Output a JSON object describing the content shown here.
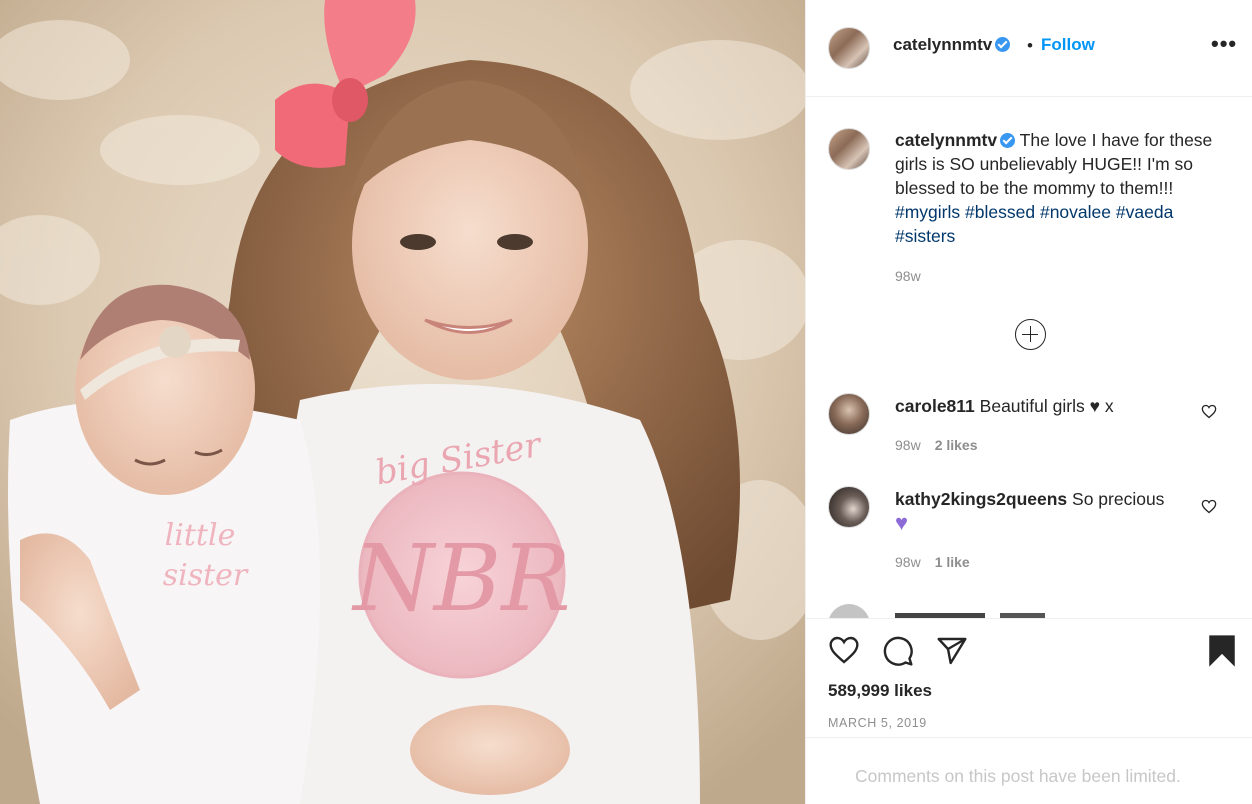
{
  "post": {
    "username": "catelynnmtv",
    "follow_label": "Follow",
    "separator": "•",
    "more_label": "•••",
    "caption_text": " The love I have for these girls is SO unbelievably HUGE!! I'm so blessed to be the mommy to them!!! ",
    "hashtags": [
      "#mygirls",
      "#blessed",
      "#novalee",
      "#vaeda",
      "#sisters"
    ],
    "caption_time": "98w",
    "likes": "589,999 likes",
    "date": "MARCH 5, 2019",
    "limited_notice": "Comments on this post have been limited.",
    "photo_text": {
      "baby_shirt_line1": "little",
      "baby_shirt_line2": "sister",
      "girl_shirt_arc": "big Sister",
      "monogram": "NBR"
    }
  },
  "comments": [
    {
      "username": "carole811",
      "text": " Beautiful girls ",
      "emoji": "♥",
      "suffix": " x",
      "time": "98w",
      "likes": "2 likes"
    },
    {
      "username": "kathy2kings2queens",
      "text": " So precious",
      "emoji": "♥",
      "time": "98w",
      "likes": "1 like"
    }
  ],
  "icons": [
    "verified-badge-icon",
    "add-comment-icon",
    "heart-icon",
    "comment-icon",
    "share-icon",
    "bookmark-icon",
    "more-options-icon"
  ],
  "colors": {
    "link": "#0095f6",
    "hashtag": "#00376b",
    "verified": "#3897f0",
    "muted": "#8e8e8e",
    "limited": "#c7c7c7",
    "bow": "#f06a78",
    "purple_heart": "#8c6bd6"
  }
}
